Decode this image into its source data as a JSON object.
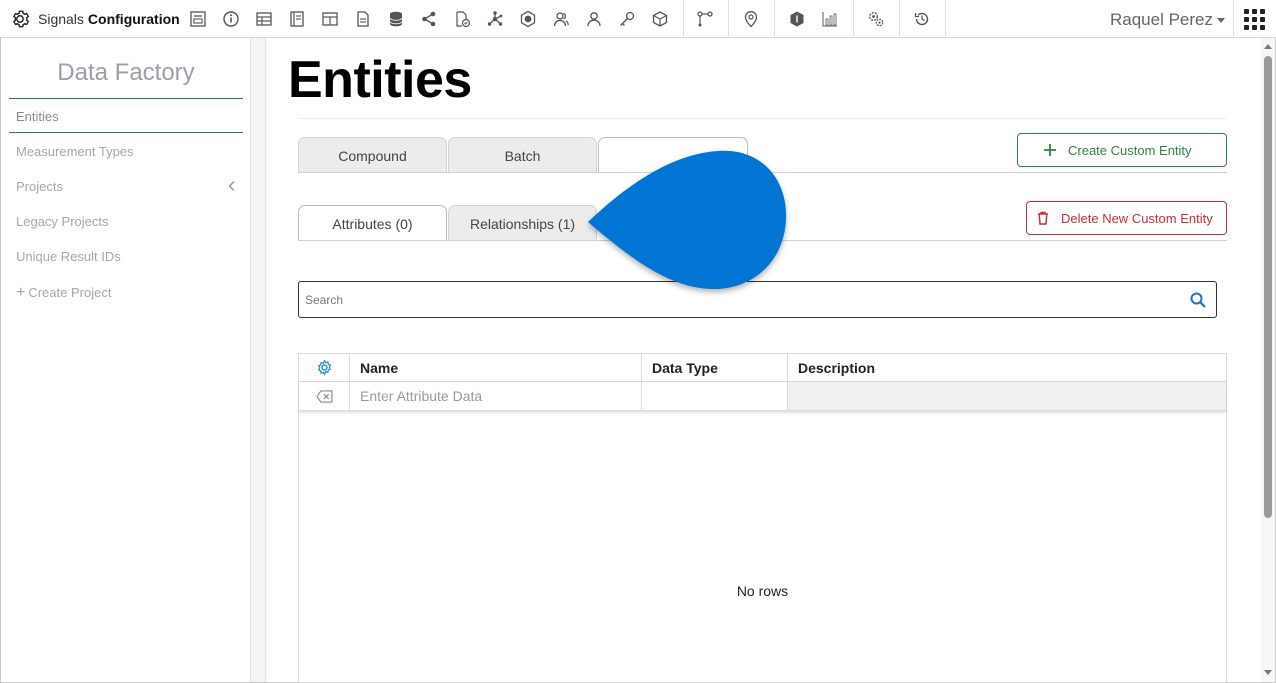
{
  "app": {
    "brand_word1": "Signals",
    "brand_word2": "Configuration",
    "user_name": "Raquel Perez",
    "toolbar_icons": [
      "form-icon",
      "info-icon",
      "table-icon",
      "notebook-icon",
      "grid-table-icon",
      "document-icon",
      "database-icon",
      "share-icon",
      "file-check-icon",
      "network-icon",
      "hexagon-badge-icon",
      "users-icon",
      "user-icon",
      "key-icon",
      "cube-icon",
      "vector-path-icon",
      "location-pin-icon",
      "shield-icon",
      "chart-icon",
      "cogs-icon",
      "history-icon"
    ]
  },
  "sidebar": {
    "title": "Data Factory",
    "items": [
      {
        "label": "Entities",
        "active": true
      },
      {
        "label": "Measurement Types"
      },
      {
        "label": "Projects"
      },
      {
        "label": "Legacy Projects"
      },
      {
        "label": "Unique Result IDs"
      },
      {
        "label": "Create Project",
        "prefix": "+"
      }
    ]
  },
  "main": {
    "title": "Entities",
    "entity_tabs": [
      {
        "label": "Compound"
      },
      {
        "label": "Batch"
      },
      {
        "label": "",
        "active": true
      }
    ],
    "sub_tabs": [
      {
        "label": "Attributes (0)",
        "active": true
      },
      {
        "label": "Relationships (1)"
      }
    ],
    "create_button": "Create Custom Entity",
    "delete_button": "Delete New Custom Entity",
    "search_placeholder": "Search",
    "grid": {
      "columns": [
        "Name",
        "Data Type",
        "Description"
      ],
      "filter_placeholder": "Enter Attribute Data",
      "empty_text": "No rows"
    }
  },
  "colors": {
    "accent_green": "#2e8540",
    "danger_red": "#c62f3a",
    "blob_blue": "#0075d4",
    "grid_gear": "#1c8fc7"
  }
}
